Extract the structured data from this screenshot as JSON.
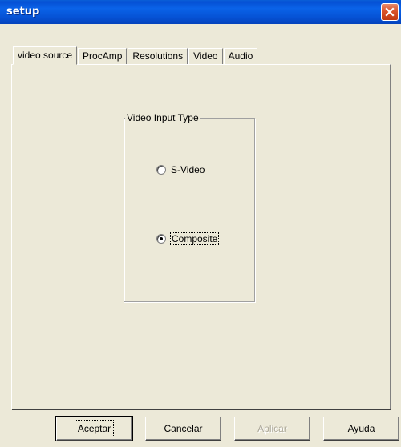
{
  "window": {
    "title": "setup",
    "close_icon": "close-icon"
  },
  "tabs": [
    {
      "label": "video source",
      "active": true
    },
    {
      "label": "ProcAmp",
      "active": false
    },
    {
      "label": "Resolutions",
      "active": false
    },
    {
      "label": "Video",
      "active": false
    },
    {
      "label": "Audio",
      "active": false
    }
  ],
  "group": {
    "title": "Video Input Type",
    "options": [
      {
        "label": "S-Video",
        "selected": false
      },
      {
        "label": "Composite",
        "selected": true
      }
    ]
  },
  "buttons": {
    "accept": "Aceptar",
    "cancel": "Cancelar",
    "apply": "Aplicar",
    "help": "Ayuda"
  },
  "colors": {
    "titlebar": "#0a5fd8",
    "close": "#d9532a",
    "face": "#ece9d8"
  }
}
